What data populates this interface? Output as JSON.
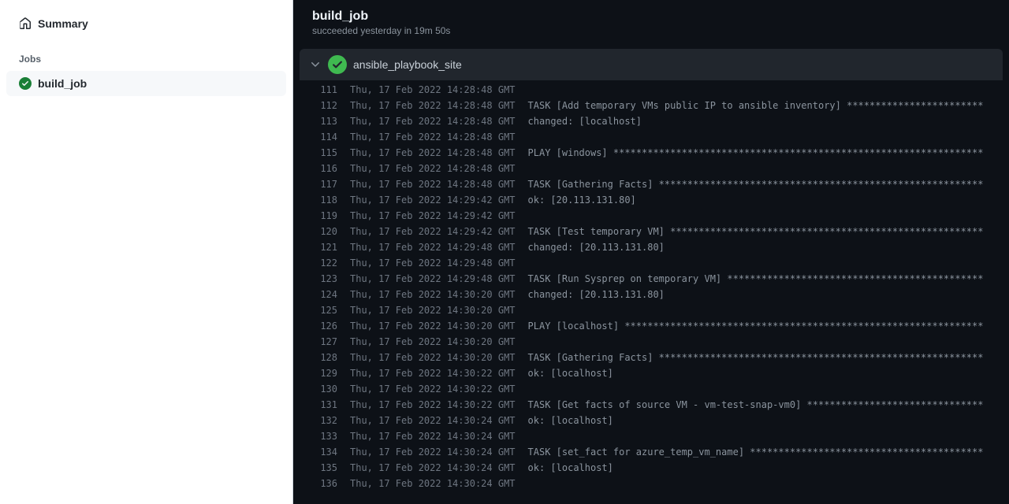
{
  "sidebar": {
    "summary_label": "Summary",
    "jobs_heading": "Jobs",
    "job_name": "build_job"
  },
  "header": {
    "title": "build_job",
    "subtitle": "succeeded yesterday in 19m 50s"
  },
  "step": {
    "name": "ansible_playbook_site"
  },
  "log": [
    {
      "n": 111,
      "ts": "Thu, 17 Feb 2022 14:28:48 GMT",
      "txt": ""
    },
    {
      "n": 112,
      "ts": "Thu, 17 Feb 2022 14:28:48 GMT",
      "txt": "TASK [Add temporary VMs public IP to ansible inventory] ************************"
    },
    {
      "n": 113,
      "ts": "Thu, 17 Feb 2022 14:28:48 GMT",
      "txt": "changed: [localhost]"
    },
    {
      "n": 114,
      "ts": "Thu, 17 Feb 2022 14:28:48 GMT",
      "txt": ""
    },
    {
      "n": 115,
      "ts": "Thu, 17 Feb 2022 14:28:48 GMT",
      "txt": "PLAY [windows] *****************************************************************"
    },
    {
      "n": 116,
      "ts": "Thu, 17 Feb 2022 14:28:48 GMT",
      "txt": ""
    },
    {
      "n": 117,
      "ts": "Thu, 17 Feb 2022 14:28:48 GMT",
      "txt": "TASK [Gathering Facts] *********************************************************"
    },
    {
      "n": 118,
      "ts": "Thu, 17 Feb 2022 14:29:42 GMT",
      "txt": "ok: [20.113.131.80]"
    },
    {
      "n": 119,
      "ts": "Thu, 17 Feb 2022 14:29:42 GMT",
      "txt": ""
    },
    {
      "n": 120,
      "ts": "Thu, 17 Feb 2022 14:29:42 GMT",
      "txt": "TASK [Test temporary VM] *******************************************************"
    },
    {
      "n": 121,
      "ts": "Thu, 17 Feb 2022 14:29:48 GMT",
      "txt": "changed: [20.113.131.80]"
    },
    {
      "n": 122,
      "ts": "Thu, 17 Feb 2022 14:29:48 GMT",
      "txt": ""
    },
    {
      "n": 123,
      "ts": "Thu, 17 Feb 2022 14:29:48 GMT",
      "txt": "TASK [Run Sysprep on temporary VM] *********************************************"
    },
    {
      "n": 124,
      "ts": "Thu, 17 Feb 2022 14:30:20 GMT",
      "txt": "changed: [20.113.131.80]"
    },
    {
      "n": 125,
      "ts": "Thu, 17 Feb 2022 14:30:20 GMT",
      "txt": ""
    },
    {
      "n": 126,
      "ts": "Thu, 17 Feb 2022 14:30:20 GMT",
      "txt": "PLAY [localhost] ***************************************************************"
    },
    {
      "n": 127,
      "ts": "Thu, 17 Feb 2022 14:30:20 GMT",
      "txt": ""
    },
    {
      "n": 128,
      "ts": "Thu, 17 Feb 2022 14:30:20 GMT",
      "txt": "TASK [Gathering Facts] *********************************************************"
    },
    {
      "n": 129,
      "ts": "Thu, 17 Feb 2022 14:30:22 GMT",
      "txt": "ok: [localhost]"
    },
    {
      "n": 130,
      "ts": "Thu, 17 Feb 2022 14:30:22 GMT",
      "txt": ""
    },
    {
      "n": 131,
      "ts": "Thu, 17 Feb 2022 14:30:22 GMT",
      "txt": "TASK [Get facts of source VM - vm-test-snap-vm0] *******************************"
    },
    {
      "n": 132,
      "ts": "Thu, 17 Feb 2022 14:30:24 GMT",
      "txt": "ok: [localhost]"
    },
    {
      "n": 133,
      "ts": "Thu, 17 Feb 2022 14:30:24 GMT",
      "txt": ""
    },
    {
      "n": 134,
      "ts": "Thu, 17 Feb 2022 14:30:24 GMT",
      "txt": "TASK [set_fact for azure_temp_vm_name] *****************************************"
    },
    {
      "n": 135,
      "ts": "Thu, 17 Feb 2022 14:30:24 GMT",
      "txt": "ok: [localhost]"
    },
    {
      "n": 136,
      "ts": "Thu, 17 Feb 2022 14:30:24 GMT",
      "txt": ""
    }
  ]
}
